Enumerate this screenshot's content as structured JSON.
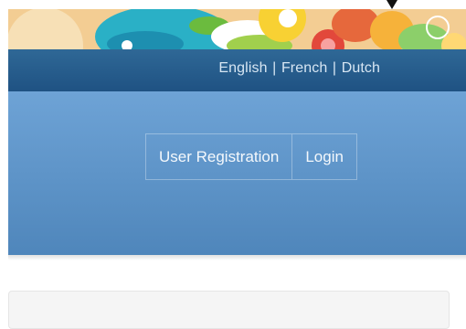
{
  "languages": {
    "english": "English",
    "separator_1": "|",
    "french": "French",
    "separator_2": "|",
    "dutch": "Dutch"
  },
  "auth": {
    "register_label": "User Registration",
    "login_label": "Login"
  },
  "colors": {
    "topbar": "#2a5f8f",
    "hero": "#5f95c9"
  }
}
